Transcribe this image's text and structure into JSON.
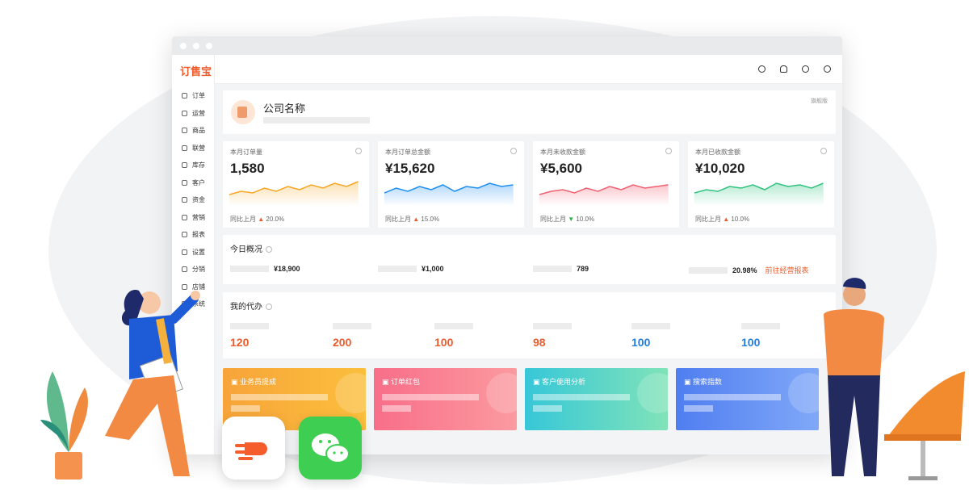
{
  "logo": "订售宝",
  "sidebar": {
    "items": [
      "订单",
      "运营",
      "商品",
      "联营",
      "库存",
      "客户",
      "资金",
      "营销",
      "报表",
      "设置",
      "分销",
      "店铺",
      "系统"
    ]
  },
  "company": {
    "name": "公司名称",
    "flag": "旗舰版"
  },
  "stats": [
    {
      "label": "本月订单量",
      "value": "1,580",
      "compare": "同比上月",
      "trend": "▲",
      "change": "20.0%",
      "color": "#f5a623"
    },
    {
      "label": "本月订单总金额",
      "value": "¥15,620",
      "compare": "同比上月",
      "trend": "▲",
      "change": "15.0%",
      "color": "#1f8ef1"
    },
    {
      "label": "本月未收款金额",
      "value": "¥5,600",
      "compare": "同比上月",
      "trend": "▼",
      "change": "10.0%",
      "color": "#f06070"
    },
    {
      "label": "本月已收款金额",
      "value": "¥10,020",
      "compare": "同比上月",
      "trend": "▲",
      "change": "10.0%",
      "color": "#2ec27e"
    }
  ],
  "overview": {
    "title": "今日概况",
    "values": [
      "¥18,900",
      "¥1,000",
      "789",
      "20.98%"
    ],
    "link": "前往经营报表"
  },
  "todo": {
    "title": "我的代办",
    "values": [
      "120",
      "200",
      "100",
      "98",
      "100",
      "100"
    ]
  },
  "banners": [
    "业务员提成",
    "订单红包",
    "客户使用分析",
    "搜索指数"
  ]
}
